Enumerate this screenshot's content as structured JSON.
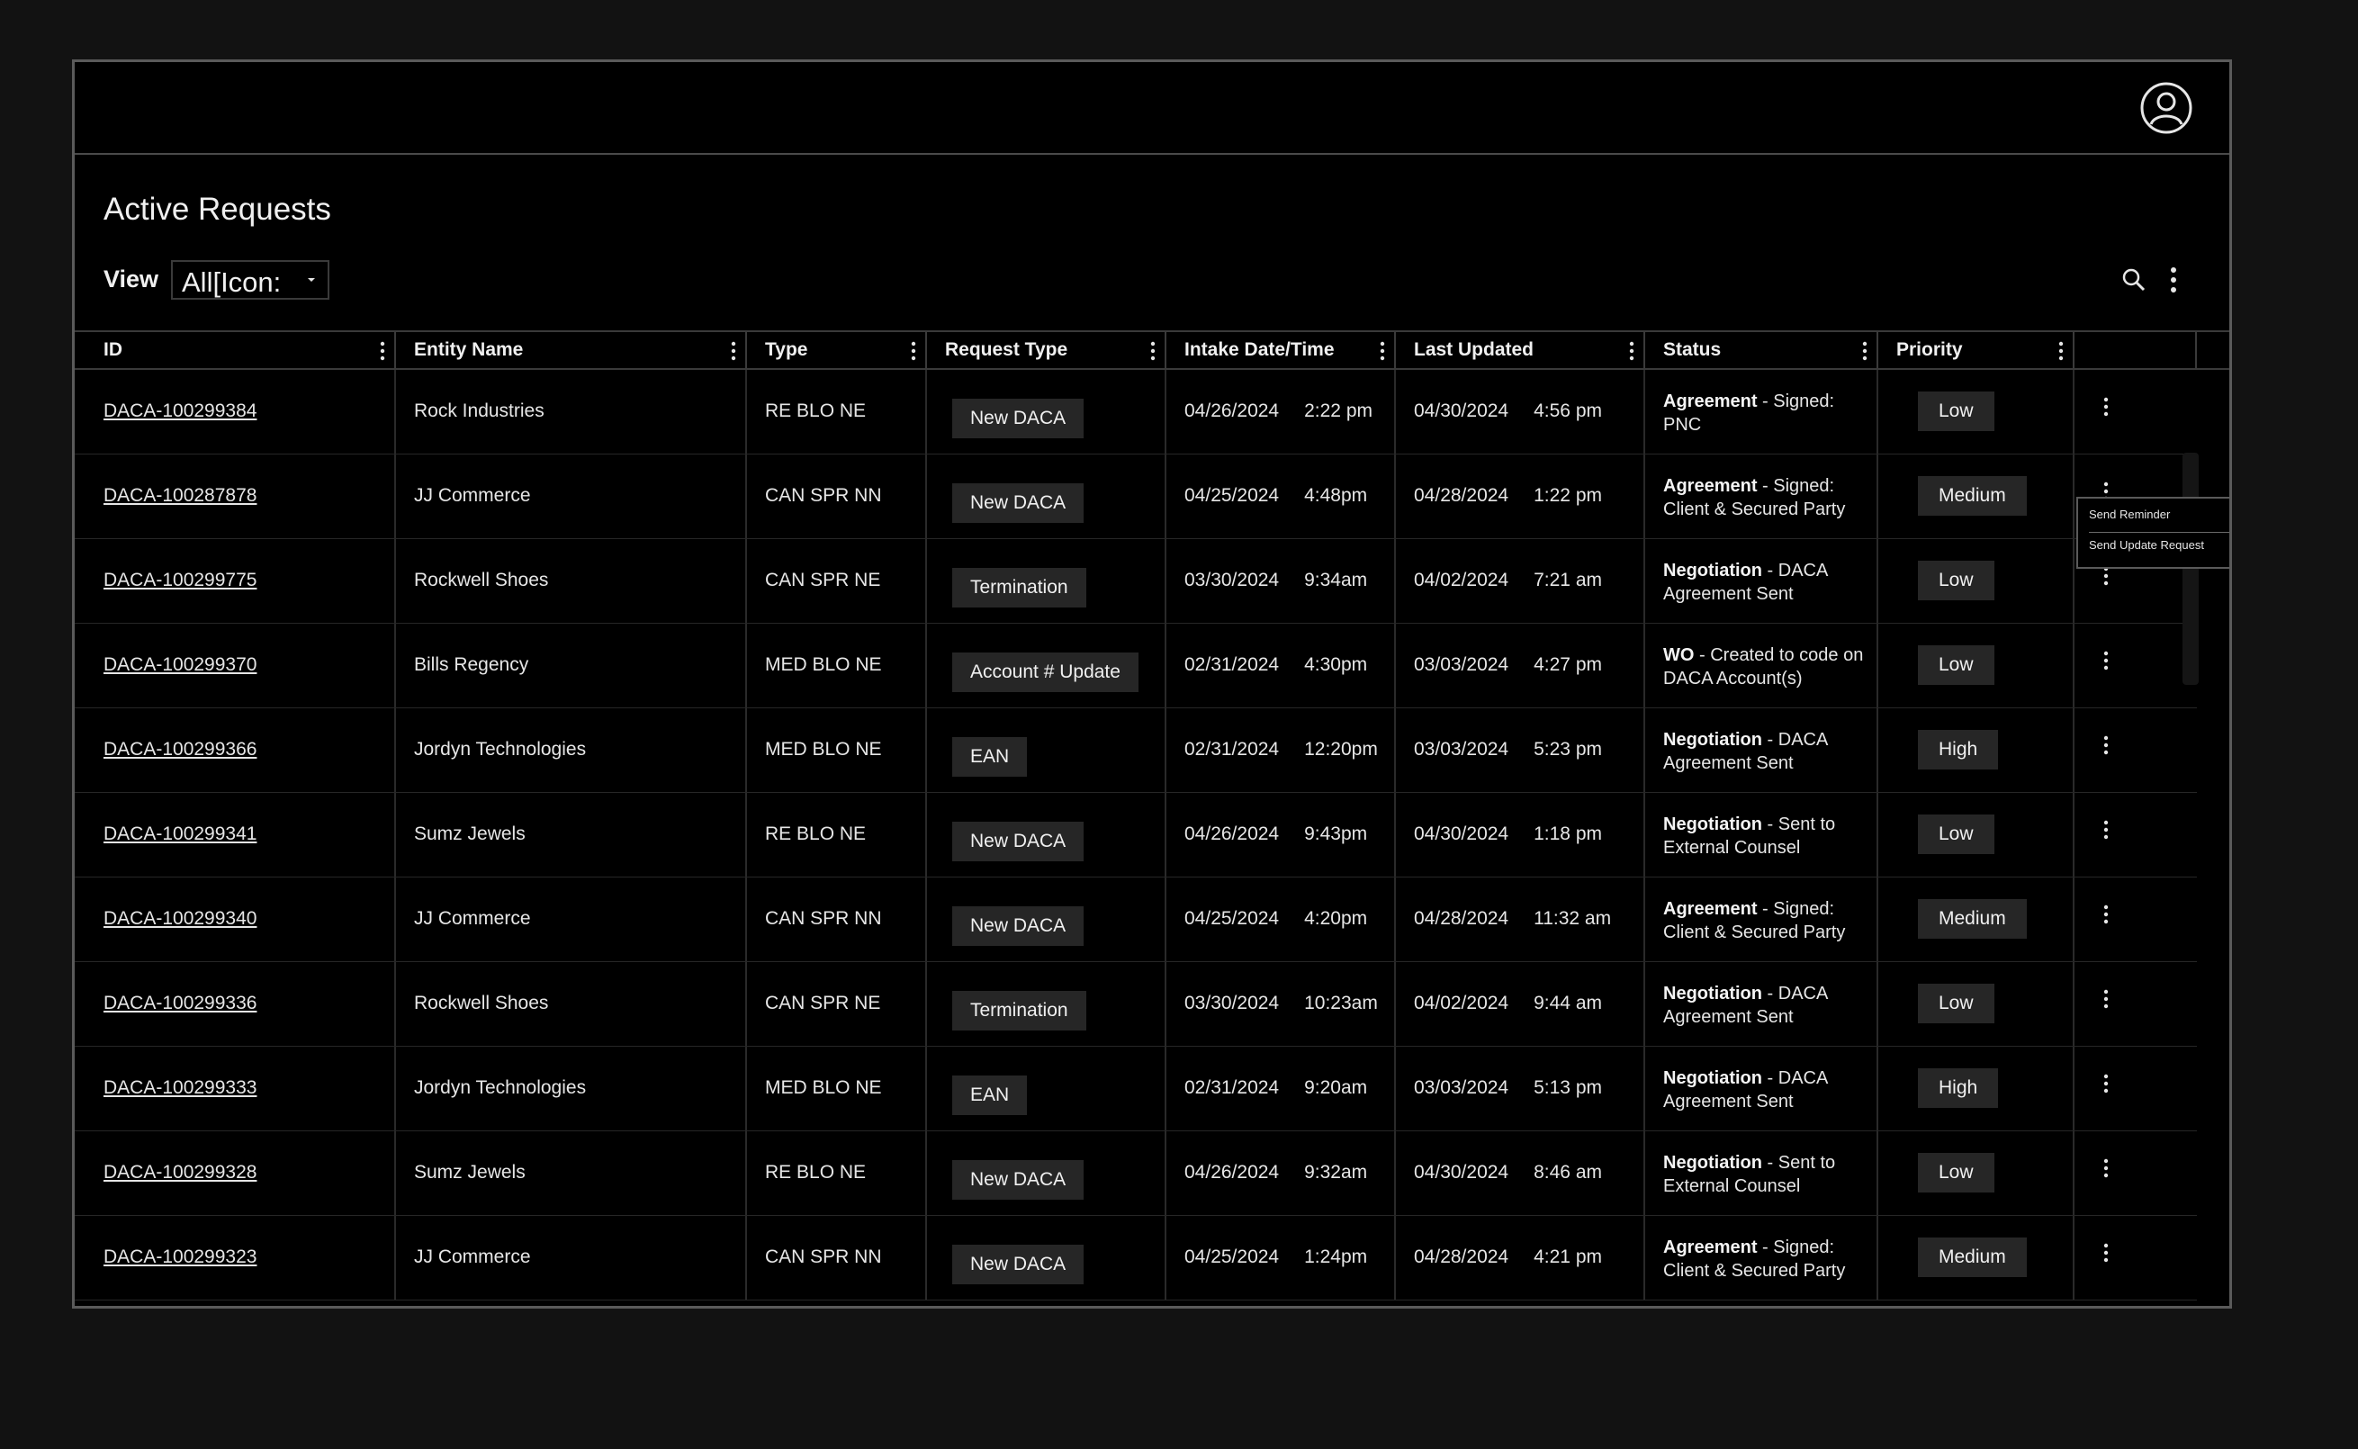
{
  "app": {
    "title": "Active Requests"
  },
  "toolbar": {
    "view_label": "View",
    "view_value": "All[Icon:",
    "search_icon": "search-icon",
    "more_icon": "vertical-dots-icon"
  },
  "header": {
    "user_icon": "user-avatar-icon"
  },
  "table": {
    "columns": [
      {
        "label": "ID"
      },
      {
        "label": "Entity Name"
      },
      {
        "label": "Type"
      },
      {
        "label": "Request Type"
      },
      {
        "label": "Intake Date/Time"
      },
      {
        "label": "Last Updated"
      },
      {
        "label": "Status"
      },
      {
        "label": "Priority"
      }
    ],
    "rows": [
      {
        "id": "DACA-100299384",
        "entity": "Rock Industries",
        "type": "RE BLO NE",
        "request": "New DACA",
        "intake_date": "04/26/2024",
        "intake_time": "2:22 pm",
        "updated_date": "04/30/2024",
        "updated_time": "4:56 pm",
        "status_label": "Agreement",
        "status_detail": " - Signed: PNC",
        "priority": "Low"
      },
      {
        "id": "DACA-100287878",
        "entity": "JJ Commerce",
        "type": "CAN SPR NN",
        "request": "New DACA",
        "intake_date": "04/25/2024",
        "intake_time": "4:48pm",
        "updated_date": "04/28/2024",
        "updated_time": "1:22 pm",
        "status_label": "Agreement",
        "status_detail": " - Signed: Client & Secured Party",
        "priority": "Medium"
      },
      {
        "id": "DACA-100299775",
        "entity": "Rockwell Shoes",
        "type": "CAN SPR NE",
        "request": "Termination",
        "intake_date": "03/30/2024",
        "intake_time": "9:34am",
        "updated_date": "04/02/2024",
        "updated_time": "7:21 am",
        "status_label": "Negotiation",
        "status_detail": " - DACA Agreement Sent",
        "priority": "Low"
      },
      {
        "id": "DACA-100299370",
        "entity": "Bills Regency",
        "type": "MED BLO NE",
        "request": "Account # Update",
        "intake_date": "02/31/2024",
        "intake_time": "4:30pm",
        "updated_date": "03/03/2024",
        "updated_time": "4:27 pm",
        "status_label": "WO",
        "status_detail": " - Created to code on DACA Account(s)",
        "priority": "Low"
      },
      {
        "id": "DACA-100299366",
        "entity": "Jordyn Technologies",
        "type": "MED BLO NE",
        "request": "EAN",
        "intake_date": "02/31/2024",
        "intake_time": "12:20pm",
        "updated_date": "03/03/2024",
        "updated_time": "5:23 pm",
        "status_label": "Negotiation",
        "status_detail": " - DACA Agreement Sent",
        "priority": "High"
      },
      {
        "id": "DACA-100299341",
        "entity": "Sumz Jewels",
        "type": "RE BLO NE",
        "request": "New DACA",
        "intake_date": "04/26/2024",
        "intake_time": "9:43pm",
        "updated_date": "04/30/2024",
        "updated_time": "1:18 pm",
        "status_label": "Negotiation",
        "status_detail": " - Sent to External Counsel",
        "priority": "Low"
      },
      {
        "id": "DACA-100299340",
        "entity": "JJ Commerce",
        "type": "CAN SPR NN",
        "request": "New DACA",
        "intake_date": "04/25/2024",
        "intake_time": "4:20pm",
        "updated_date": "04/28/2024",
        "updated_time": "11:32 am",
        "status_label": "Agreement",
        "status_detail": " - Signed: Client & Secured Party",
        "priority": "Medium"
      },
      {
        "id": "DACA-100299336",
        "entity": "Rockwell Shoes",
        "type": "CAN SPR NE",
        "request": "Termination",
        "intake_date": "03/30/2024",
        "intake_time": "10:23am",
        "updated_date": "04/02/2024",
        "updated_time": "9:44 am",
        "status_label": "Negotiation",
        "status_detail": " - DACA Agreement Sent",
        "priority": "Low"
      },
      {
        "id": "DACA-100299333",
        "entity": "Jordyn Technologies",
        "type": "MED BLO NE",
        "request": "EAN",
        "intake_date": "02/31/2024",
        "intake_time": "9:20am",
        "updated_date": "03/03/2024",
        "updated_time": "5:13 pm",
        "status_label": "Negotiation",
        "status_detail": " - DACA Agreement Sent",
        "priority": "High"
      },
      {
        "id": "DACA-100299328",
        "entity": "Sumz Jewels",
        "type": "RE BLO NE",
        "request": "New DACA",
        "intake_date": "04/26/2024",
        "intake_time": "9:32am",
        "updated_date": "04/30/2024",
        "updated_time": "8:46 am",
        "status_label": "Negotiation",
        "status_detail": " - Sent to External Counsel",
        "priority": "Low"
      },
      {
        "id": "DACA-100299323",
        "entity": "JJ Commerce",
        "type": "CAN SPR NN",
        "request": "New DACA",
        "intake_date": "04/25/2024",
        "intake_time": "1:24pm",
        "updated_date": "04/28/2024",
        "updated_time": "4:21 pm",
        "status_label": "Agreement",
        "status_detail": " - Signed: Client & Secured Party",
        "priority": "Medium"
      }
    ]
  },
  "context_menu": {
    "items": [
      {
        "label": "Send Reminder"
      },
      {
        "label": "Send Update Request"
      }
    ]
  },
  "colors": {
    "page_bg": "#121212",
    "panel_bg": "#000000",
    "chip_bg": "#262626",
    "border": "#3a3a3a"
  }
}
